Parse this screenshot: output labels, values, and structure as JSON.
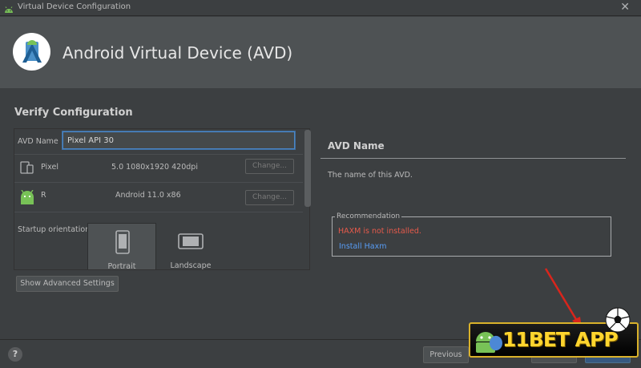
{
  "window": {
    "title": "Virtual Device Configuration",
    "close_glyph": "✕"
  },
  "header": {
    "title": "Android Virtual Device (AVD)"
  },
  "section_title": "Verify Configuration",
  "form": {
    "avd_name_label": "AVD Name",
    "avd_name_value": "Pixel API 30",
    "device": {
      "name": "Pixel",
      "spec": "5.0 1080x1920 420dpi",
      "change_label": "Change..."
    },
    "system_image": {
      "name": "R",
      "spec": "Android 11.0 x86",
      "change_label": "Change..."
    },
    "startup_orientation_label": "Startup orientation",
    "orientations": [
      {
        "label": "Portrait",
        "selected": true
      },
      {
        "label": "Landscape",
        "selected": false
      }
    ],
    "show_advanced_label": "Show Advanced Settings"
  },
  "info": {
    "title": "AVD Name",
    "description": "The name of this AVD.",
    "recommendation": {
      "legend": "Recommendation",
      "message": "HAXM is not installed.",
      "link": "Install Haxm"
    }
  },
  "footer": {
    "help_glyph": "?",
    "previous_label": "Previous"
  },
  "overlay": {
    "banner_text": "11BET APP"
  },
  "colors": {
    "background": "#3c3f41",
    "header": "#4e5254",
    "error": "#e65a4b",
    "link": "#589df6",
    "input_focus": "#4b86c7",
    "android_green": "#78c257",
    "banner_gold": "#ffd52e"
  },
  "icons": [
    "android-icon",
    "close-icon",
    "avd-logo-icon",
    "phone-tablet-icon",
    "android-head-icon",
    "portrait-phone-icon",
    "landscape-phone-icon",
    "help-icon"
  ]
}
